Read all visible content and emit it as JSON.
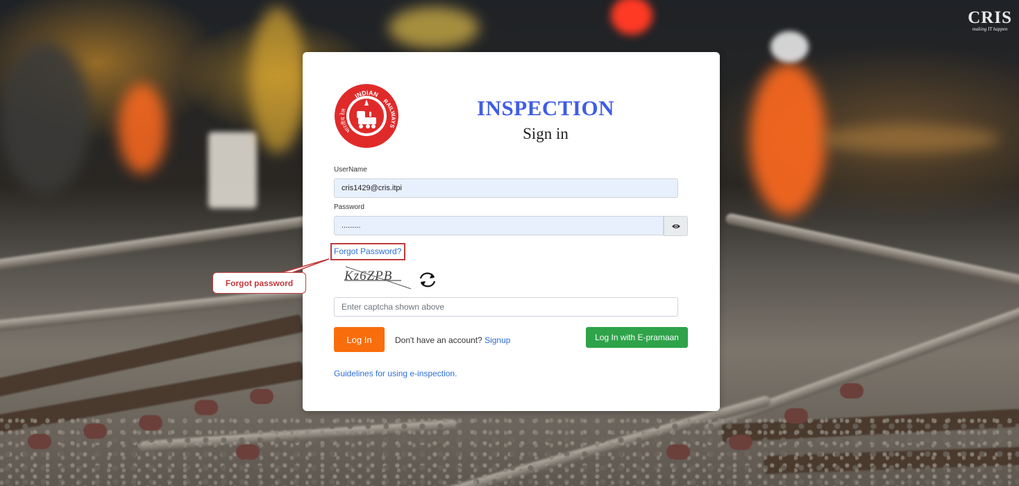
{
  "brand": {
    "name": "CRIS",
    "tagline": "making IT happen"
  },
  "emblem": {
    "top_text": "INDIAN",
    "side_text": "RAILWAYS",
    "hindi_text": "भारतीय रेल",
    "color": "#e02a2a"
  },
  "login": {
    "title": "INSPECTION",
    "subtitle": "Sign in",
    "username_label": "UserName",
    "username_value": "cris1429@cris.itpi",
    "password_label": "Password",
    "password_value": ".........",
    "forgot_password": "Forgot Password?",
    "captcha_text": "Kz6ZPB",
    "captcha_placeholder": "Enter captcha shown above",
    "login_button": "Log In",
    "signup_prompt": "Don't have an account?",
    "signup_link": "Signup",
    "epramaan_button": "Log In with E-pramaan",
    "guidelines_link": "Guidelines for using e-inspection."
  },
  "annotation": {
    "callout": "Forgot password",
    "color": "#c0393b"
  },
  "colors": {
    "title": "#3f5de5",
    "login_button": "#f96d0c",
    "epramaan_button": "#2ea34a",
    "link": "#2e6fd8"
  }
}
